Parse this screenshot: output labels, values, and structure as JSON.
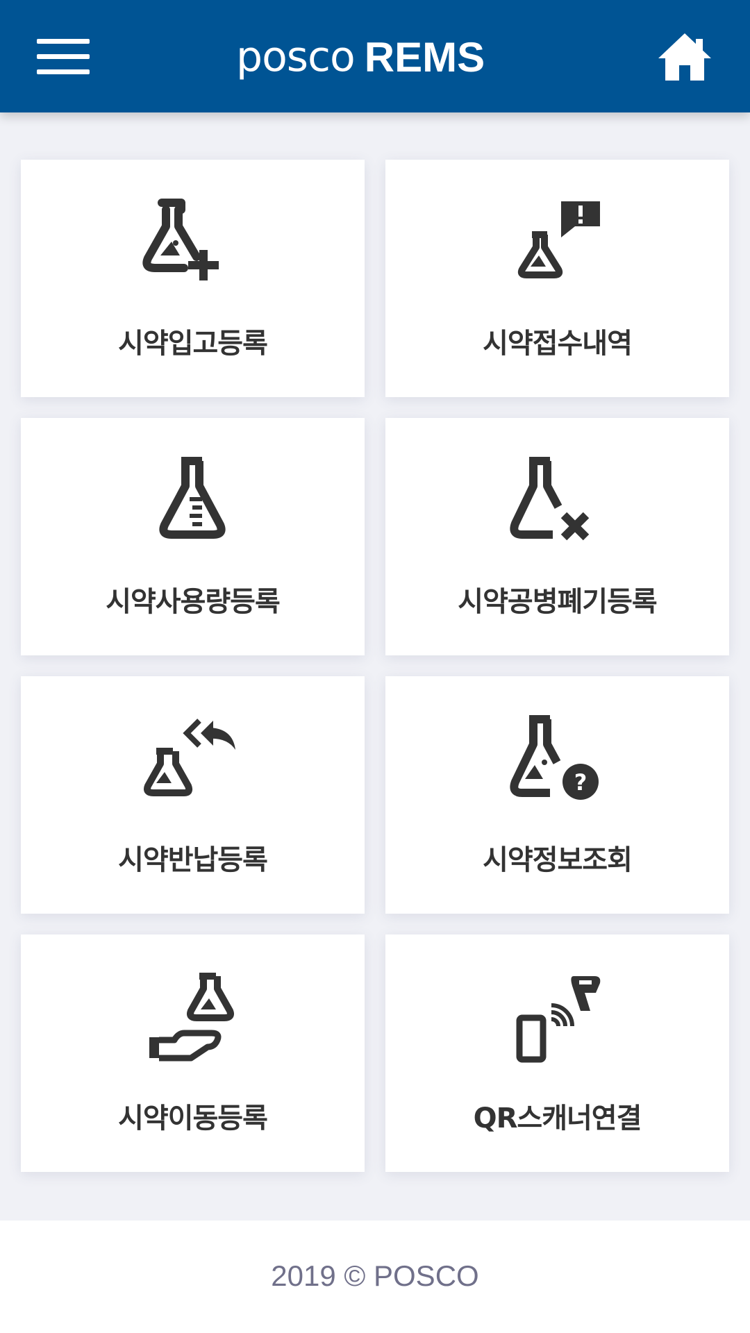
{
  "header": {
    "brand_logo": "posco",
    "brand_app": "REMS",
    "menu_icon": "hamburger-menu-icon",
    "home_icon": "home-icon",
    "color": "#005494"
  },
  "tiles": [
    {
      "label": "시약입고등록",
      "icon": "flask-plus-icon"
    },
    {
      "label": "시약접수내역",
      "icon": "flask-alert-message-icon"
    },
    {
      "label": "시약사용량등록",
      "icon": "graduated-flask-icon"
    },
    {
      "label": "시약공병폐기등록",
      "icon": "flask-close-icon"
    },
    {
      "label": "시약반납등록",
      "icon": "flask-return-icon"
    },
    {
      "label": "시약정보조회",
      "icon": "flask-question-icon"
    },
    {
      "label": "시약이동등록",
      "icon": "hand-flask-icon"
    },
    {
      "label": "QR스캐너연결",
      "icon": "phone-scanner-icon"
    }
  ],
  "footer": {
    "text": "2019 © POSCO"
  }
}
